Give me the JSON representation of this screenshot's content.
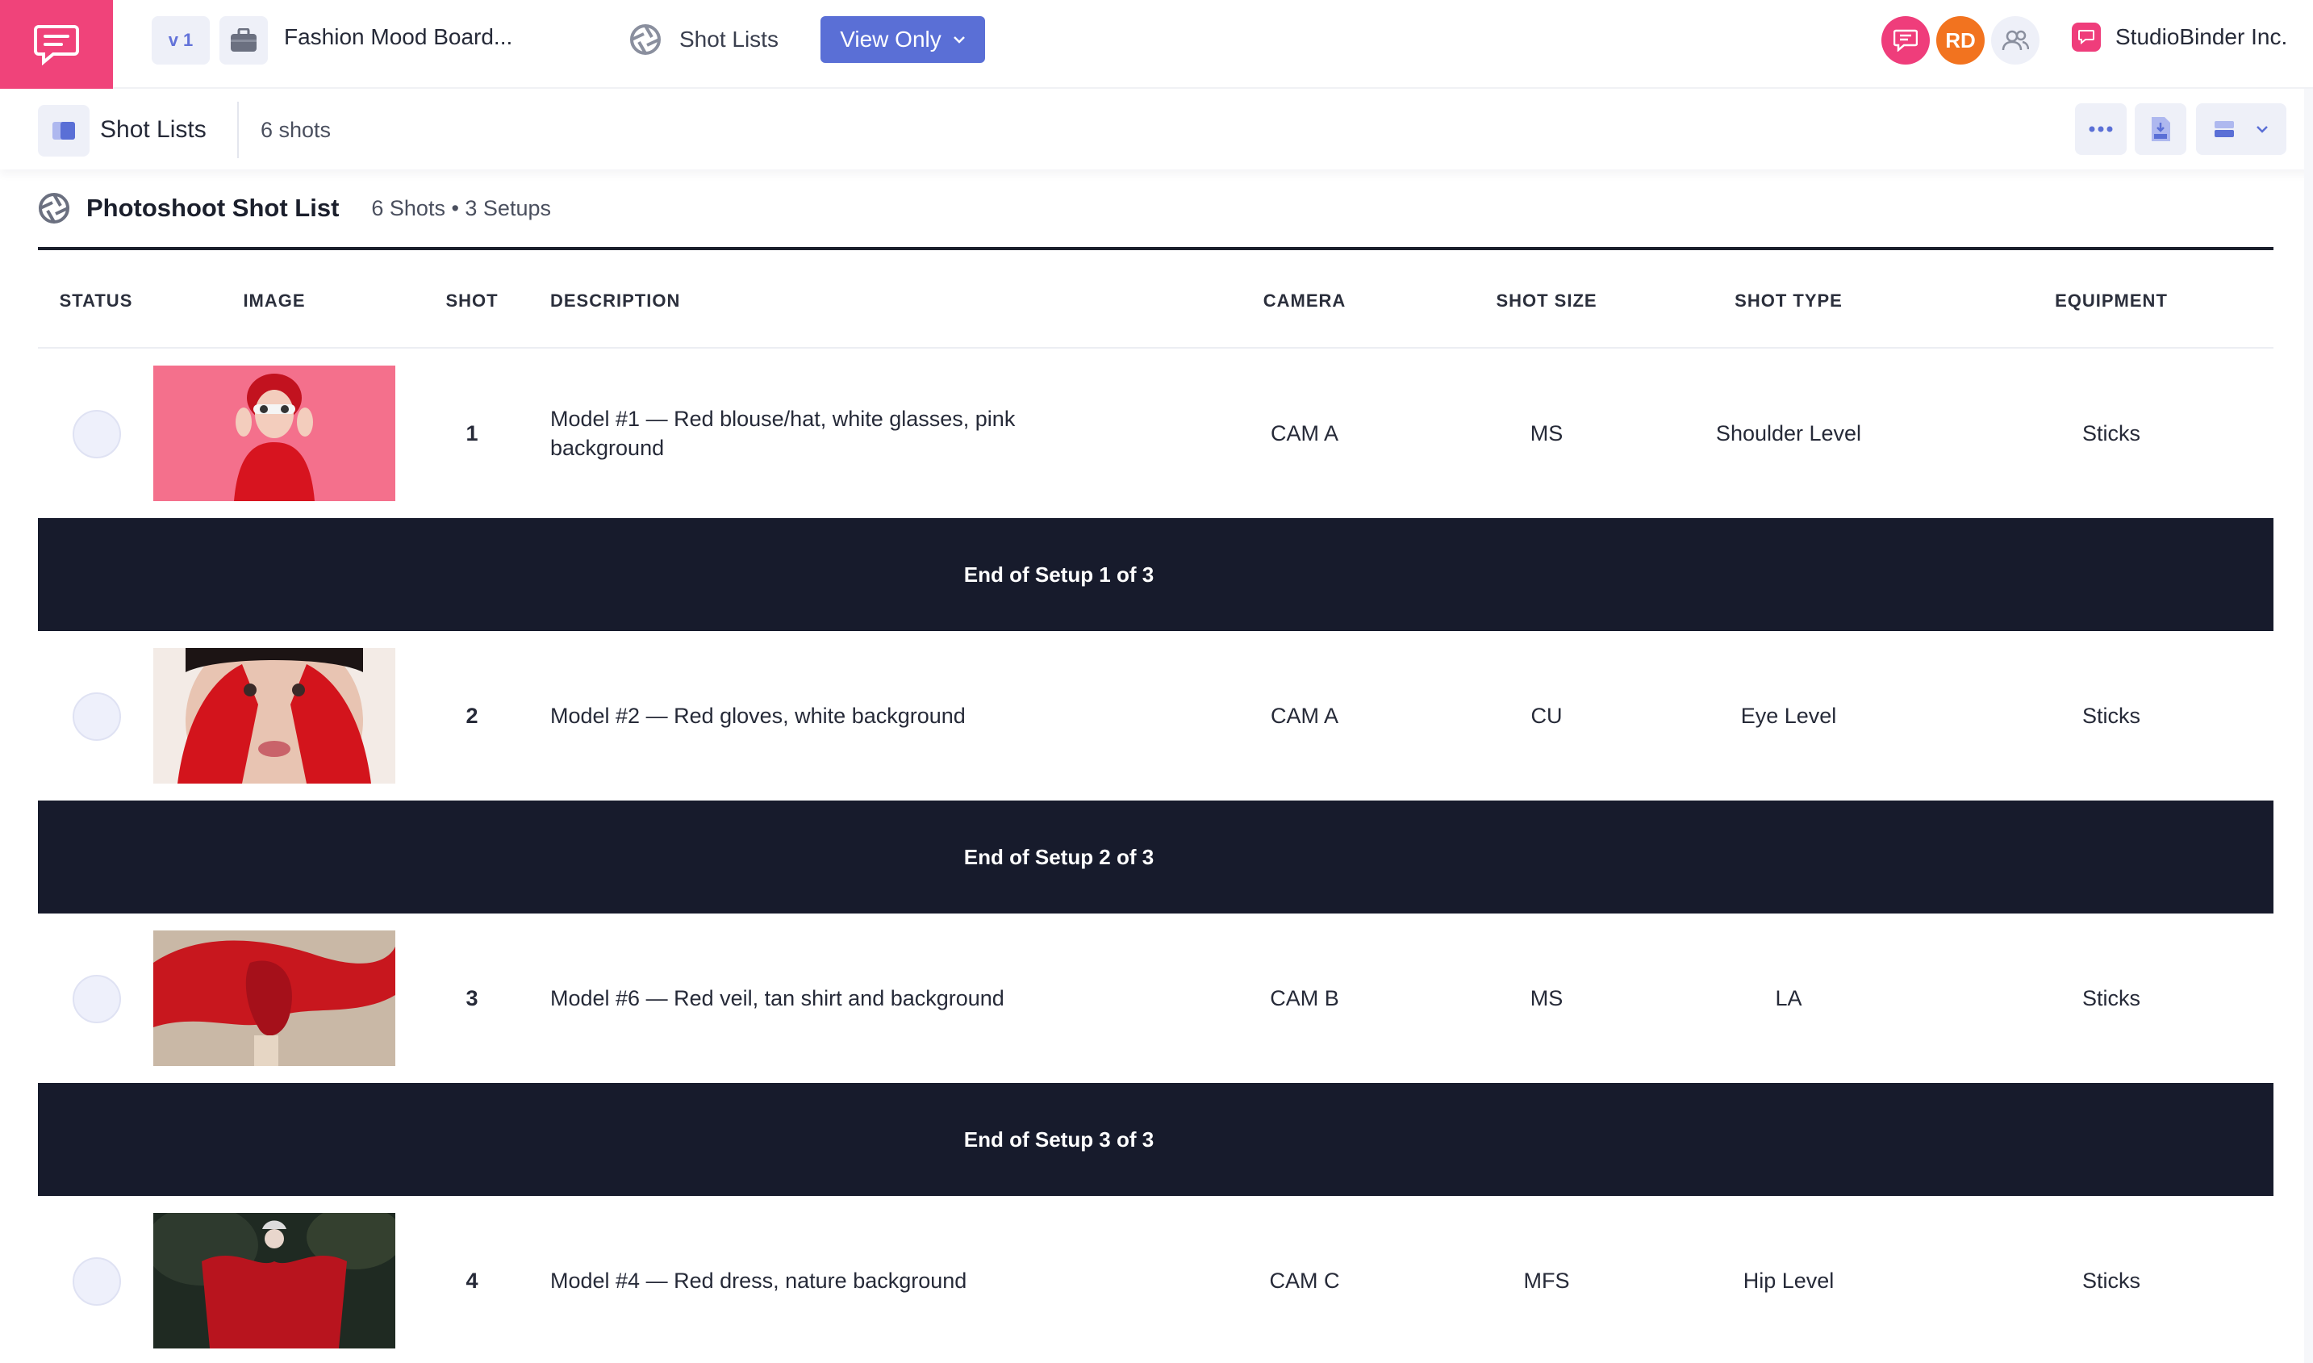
{
  "topbar": {
    "version": "v 1",
    "project_title": "Fashion Mood Board...",
    "shot_lists_tab": "Shot Lists",
    "view_only_label": "View Only",
    "user_initials": "RD",
    "company": "StudioBinder Inc.",
    "colors": {
      "brand": "#f0437a",
      "accent": "#5a6fd6",
      "rd_avatar": "#f2731f"
    }
  },
  "subbar": {
    "title": "Shot Lists",
    "count": "6 shots"
  },
  "list": {
    "title": "Photoshoot Shot List",
    "meta": "6 Shots • 3 Setups",
    "columns": {
      "status": "STATUS",
      "image": "IMAGE",
      "shot": "SHOT",
      "description": "DESCRIPTION",
      "camera": "CAMERA",
      "shot_size": "SHOT SIZE",
      "shot_type": "SHOT TYPE",
      "equipment": "EQUIPMENT"
    },
    "rows": [
      {
        "shot": "1",
        "description": "Model #1 — Red blouse/hat, white glasses, pink background",
        "camera": "CAM A",
        "shot_size": "MS",
        "shot_type": "Shoulder Level",
        "equipment": "Sticks"
      },
      {
        "shot": "2",
        "description": "Model #2 — Red gloves, white background",
        "camera": "CAM A",
        "shot_size": "CU",
        "shot_type": "Eye Level",
        "equipment": "Sticks"
      },
      {
        "shot": "3",
        "description": "Model #6 — Red veil, tan shirt and background",
        "camera": "CAM B",
        "shot_size": "MS",
        "shot_type": "LA",
        "equipment": "Sticks"
      },
      {
        "shot": "4",
        "description": "Model #4 — Red dress, nature background",
        "camera": "CAM C",
        "shot_size": "MFS",
        "shot_type": "Hip Level",
        "equipment": "Sticks"
      }
    ],
    "setups": [
      {
        "label": "End of  Setup 1 of 3"
      },
      {
        "label": "End of  Setup 2 of 3"
      },
      {
        "label": "End of  Setup 3 of 3"
      }
    ]
  }
}
